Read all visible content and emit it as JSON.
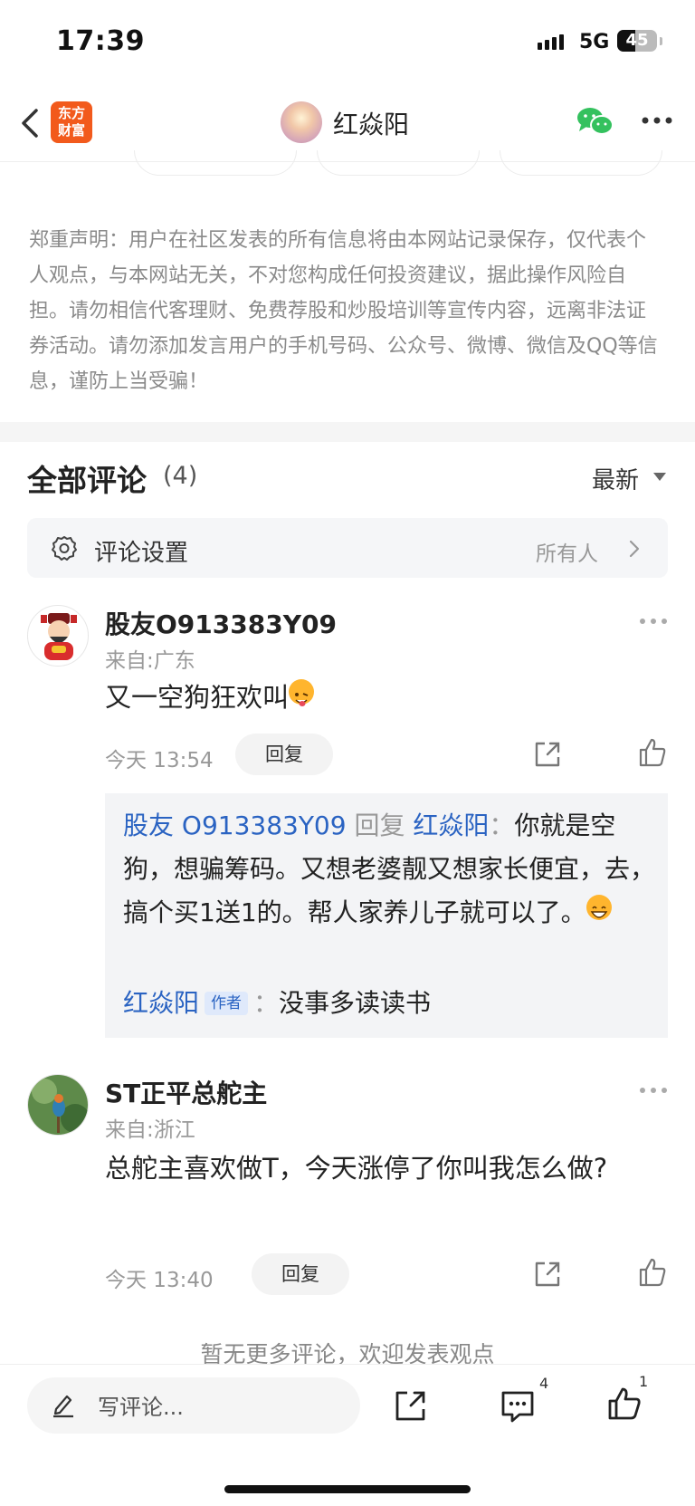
{
  "status_bar": {
    "time": "17:39",
    "network": "5G",
    "battery": "45",
    "battery_level": 0.45
  },
  "nav": {
    "logo_line1": "东方",
    "logo_line2": "财富",
    "title": "红焱阳",
    "icons": [
      "back-icon",
      "wechat-icon",
      "more-icon"
    ]
  },
  "disclaimer": "郑重声明：用户在社区发表的所有信息将由本网站记录保存，仅代表个人观点，与本网站无关，不对您构成任何投资建议，据此操作风险自担。请勿相信代客理财、免费荐股和炒股培训等宣传内容，远离非法证券活动。请勿添加发言用户的手机号码、公众号、微博、微信及QQ等信息，谨防上当受骗！",
  "comments_header": {
    "title": "全部评论",
    "count": "(4)",
    "sort_label": "最新"
  },
  "comment_settings": {
    "label": "评论设置",
    "value": "所有人"
  },
  "comments": [
    {
      "user": "股友O913383Y09",
      "location": "来自:广东",
      "text": "又一空狗狂欢叫",
      "time": "今天 13:54",
      "reply_label": "回复",
      "replies": [
        {
          "from": "股友 O913383Y09",
          "verb": "回复",
          "to": "红焱阳",
          "colon": "：",
          "text": "你就是空狗，想骗筹码。又想老婆靓又想家长便宜，去，搞个买1送1的。帮人家养儿子就可以了。"
        },
        {
          "from": "红焱阳",
          "tag": "作者",
          "colon": "：",
          "text": "没事多读读书"
        }
      ]
    },
    {
      "user": "ST正平总舵主",
      "location": "来自:浙江",
      "text": "总舵主喜欢做T，今天涨停了你叫我怎么做?",
      "time": "今天 13:40",
      "reply_label": "回复"
    }
  ],
  "no_more": "暂无更多评论，欢迎发表观点",
  "bottom_bar": {
    "placeholder": "写评论...",
    "comment_count": "4",
    "like_count": "1"
  },
  "colors": {
    "brand": "#f25a1c",
    "link": "#2a63c2",
    "wechat": "#34c15e"
  }
}
